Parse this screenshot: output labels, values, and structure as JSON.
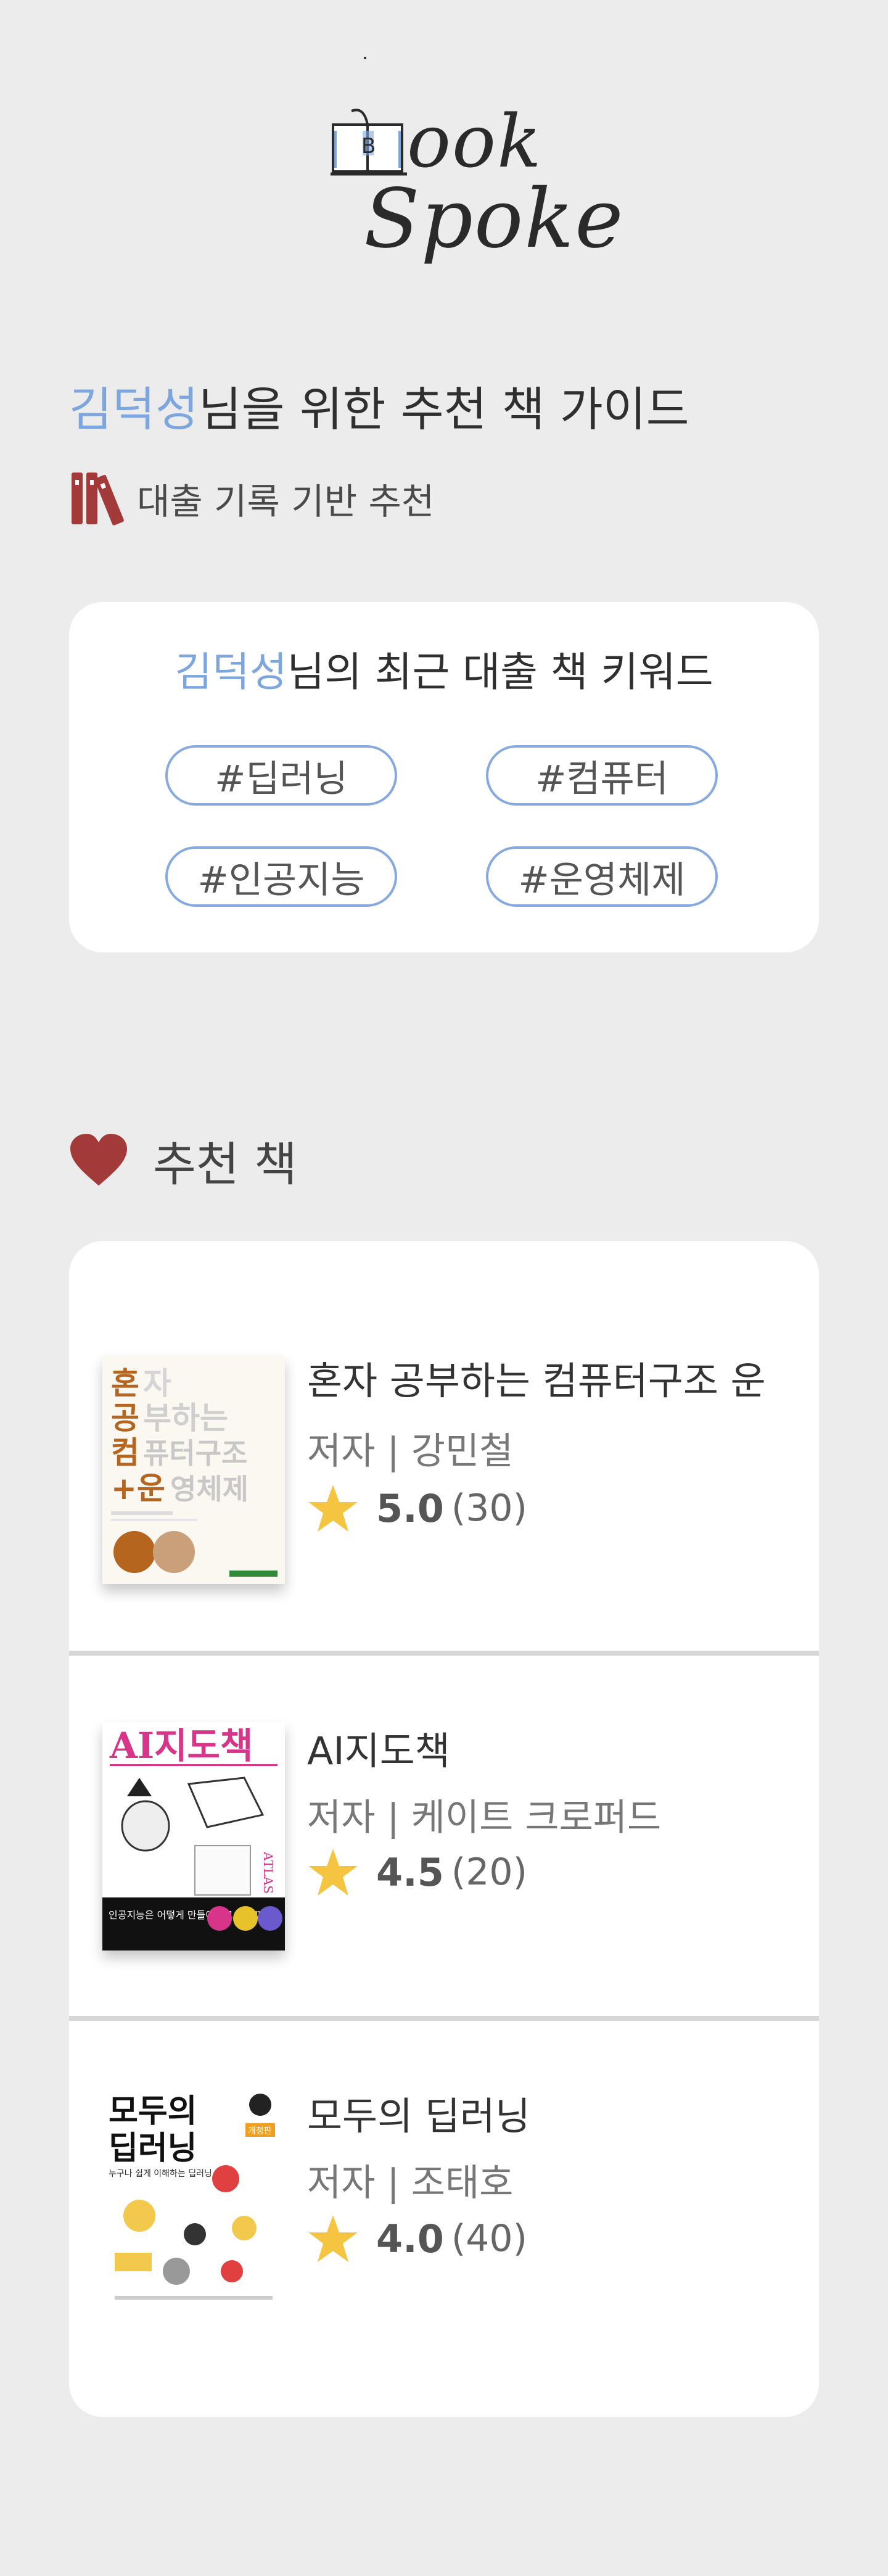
{
  "logo": {
    "word1": "ook",
    "word2": "Spoke"
  },
  "header": {
    "user_name": "김덕성",
    "title_suffix": "님을 위한 추천 책 가이드",
    "subtitle": "대출 기록 기반 추천"
  },
  "keywords": {
    "user_name": "김덕성",
    "title_suffix": "님의 최근 대출 책 키워드",
    "tags": [
      "#딥러닝",
      "#컴퓨터",
      "#인공지능",
      "#운영체제"
    ]
  },
  "recommend": {
    "heading": "추천 책",
    "books": [
      {
        "title": "혼자 공부하는 컴퓨터구조 운",
        "author": "저자 | 강민철",
        "score": "5.0",
        "count": "(30)",
        "cover": {
          "line1a": "혼",
          "line1b": "자",
          "line2a": "공",
          "line2b": "부하는",
          "line3a": "컴",
          "line3b": "퓨터구조",
          "line4a": "+운",
          "line4b": "영체제"
        }
      },
      {
        "title": "AI지도책",
        "author": "저자 |  케이트 크로퍼드",
        "score": "4.5",
        "count": "(20)",
        "cover": {
          "title": "AI지도책",
          "side": "ATLAS",
          "question": "인공지능은 어떻게 만들어지고 있을까?"
        }
      },
      {
        "title": "모두의 딥러닝",
        "author": "저자 |  조태호",
        "score": "4.0",
        "count": "(40)",
        "cover": {
          "line1": "모두의",
          "line2": "딥러닝",
          "tag": "개정판",
          "small": "누구나 쉽게 이해하는 딥러닝"
        }
      }
    ]
  },
  "colors": {
    "accent_blue": "#7ea6de",
    "icon_red": "#a33a3a",
    "star": "#f5c542",
    "background": "#ececec"
  }
}
